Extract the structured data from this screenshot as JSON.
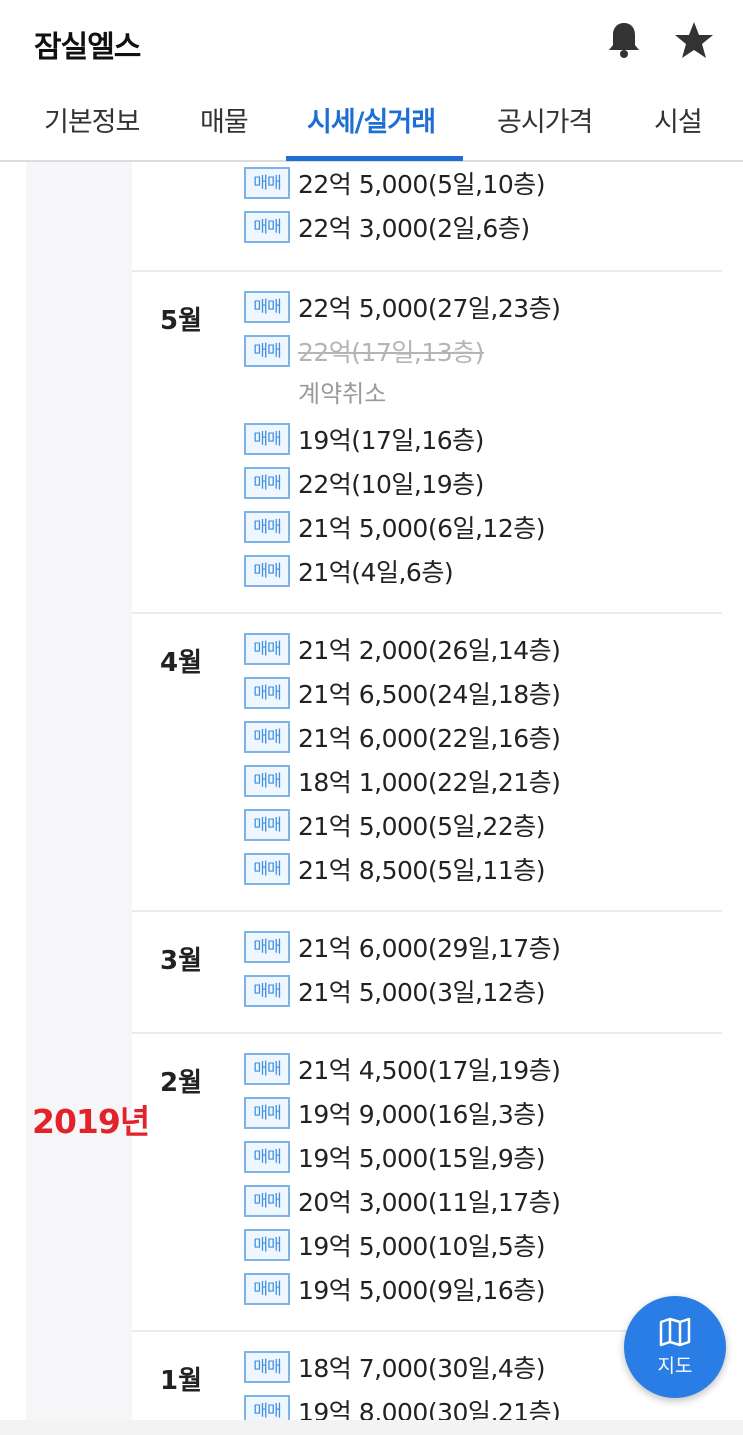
{
  "header": {
    "title": "잠실엘스",
    "icons": [
      "bell-icon",
      "star-icon"
    ]
  },
  "tabs": [
    {
      "label": "기본정보",
      "active": false
    },
    {
      "label": "매물",
      "active": false
    },
    {
      "label": "시세/실거래",
      "active": true
    },
    {
      "label": "공시가격",
      "active": false
    },
    {
      "label": "시설",
      "active": false
    }
  ],
  "colors": {
    "accent": "#1f6ed4",
    "badge": "#3f8ee0",
    "year_highlight": "#e3232c"
  },
  "year": "2019년",
  "badge_label": "매매",
  "top_rows": [
    {
      "price": "22억 5,000(5일,10층)"
    },
    {
      "price": "22억 3,000(2일,6층)"
    }
  ],
  "months": [
    {
      "label": "5월",
      "rows": [
        {
          "price": "22억 5,000(27일,23층)"
        },
        {
          "price": "22억(17일,13층)",
          "cancelled": true,
          "note": "계약취소"
        },
        {
          "price": "19억(17일,16층)"
        },
        {
          "price": "22억(10일,19층)"
        },
        {
          "price": "21억 5,000(6일,12층)"
        },
        {
          "price": "21억(4일,6층)"
        }
      ]
    },
    {
      "label": "4월",
      "rows": [
        {
          "price": "21억 2,000(26일,14층)"
        },
        {
          "price": "21억 6,500(24일,18층)"
        },
        {
          "price": "21억 6,000(22일,16층)"
        },
        {
          "price": "18억 1,000(22일,21층)"
        },
        {
          "price": "21억 5,000(5일,22층)"
        },
        {
          "price": "21억 8,500(5일,11층)"
        }
      ]
    },
    {
      "label": "3월",
      "rows": [
        {
          "price": "21억 6,000(29일,17층)"
        },
        {
          "price": "21억 5,000(3일,12층)"
        }
      ]
    },
    {
      "label": "2월",
      "rows": [
        {
          "price": "21억 4,500(17일,19층)"
        },
        {
          "price": "19억 9,000(16일,3층)"
        },
        {
          "price": "19억 5,000(15일,9층)"
        },
        {
          "price": "20억 3,000(11일,17층)"
        },
        {
          "price": "19억 5,000(10일,5층)"
        },
        {
          "price": "19억 5,000(9일,16층)"
        }
      ]
    },
    {
      "label": "1월",
      "rows": [
        {
          "price": "18억 7,000(30일,4층)"
        },
        {
          "price": "19억 8,000(30일,21층)"
        }
      ]
    }
  ],
  "fab": {
    "label": "지도",
    "icon": "map-icon"
  }
}
